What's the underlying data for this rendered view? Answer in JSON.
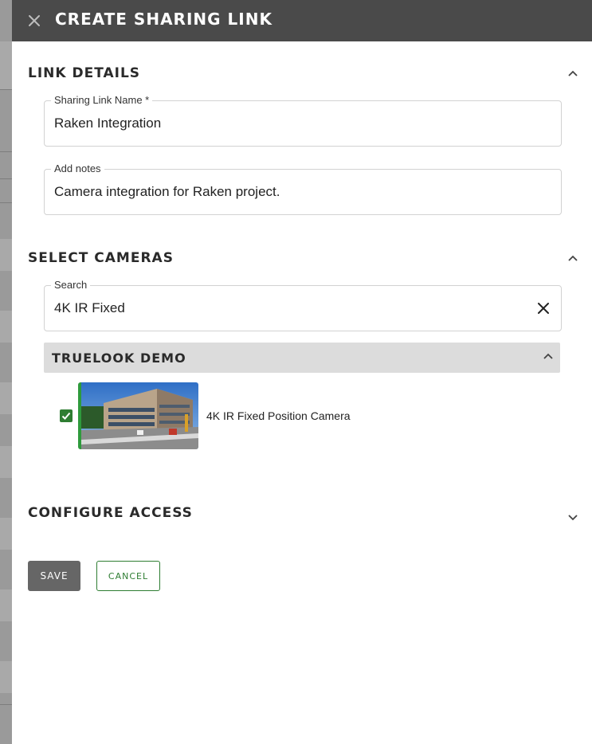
{
  "header": {
    "title": "CREATE SHARING LINK"
  },
  "link_details": {
    "title": "LINK DETAILS",
    "name_field": {
      "label": "Sharing Link Name *",
      "value": "Raken Integration"
    },
    "notes_field": {
      "label": "Add notes",
      "value": "Camera integration for Raken project."
    }
  },
  "select_cameras": {
    "title": "SELECT CAMERAS",
    "search": {
      "label": "Search",
      "value": "4K IR Fixed"
    },
    "group": {
      "title": "TRUELOOK DEMO",
      "cameras": [
        {
          "name": "4K IR Fixed Position Camera",
          "checked": true
        }
      ]
    }
  },
  "configure_access": {
    "title": "CONFIGURE ACCESS"
  },
  "actions": {
    "save_label": "SAVE",
    "cancel_label": "CANCEL"
  },
  "colors": {
    "topbar": "#4a4a4a",
    "accent_green": "#2e7d32",
    "save_button": "#666666",
    "group_header": "#dcdcdc"
  },
  "icons": {
    "close": "close-icon",
    "collapse": "chevron-up-icon",
    "expand": "chevron-down-icon",
    "clear": "clear-icon",
    "check": "check-icon"
  }
}
